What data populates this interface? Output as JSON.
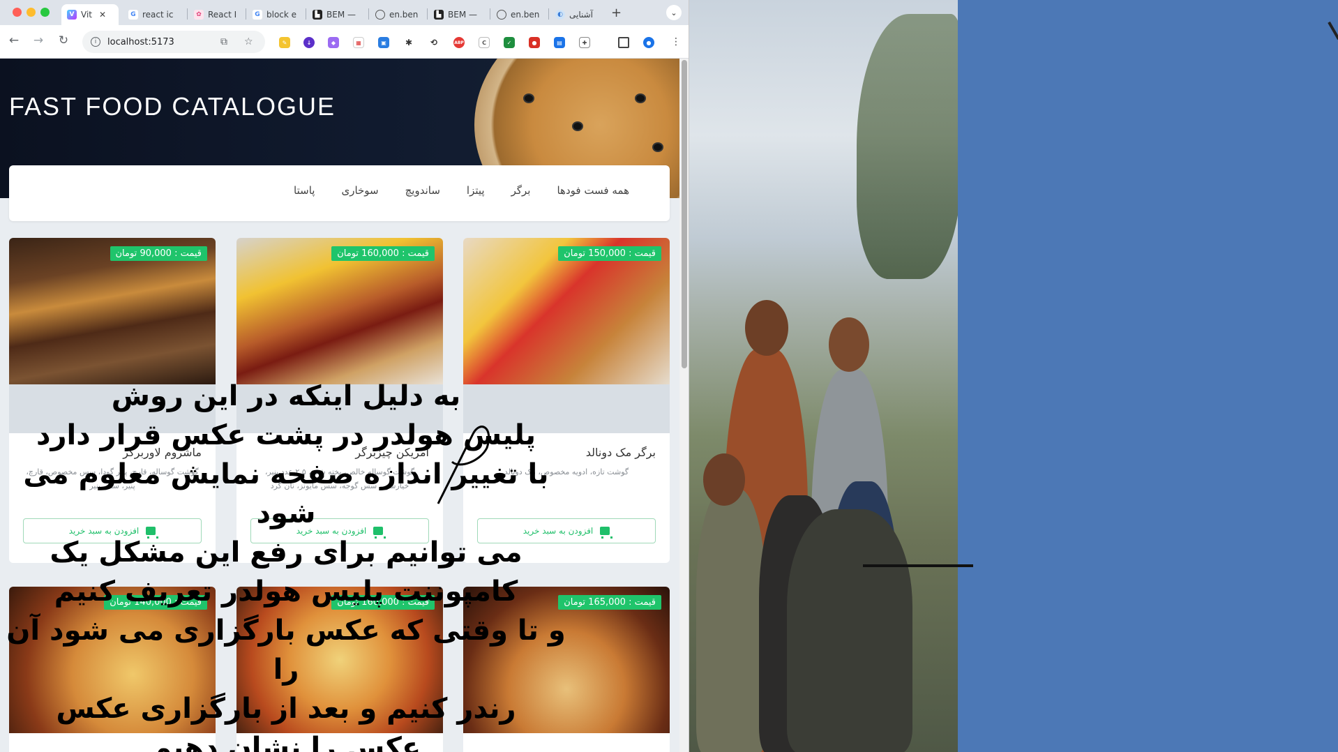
{
  "browser": {
    "tabs": [
      {
        "label": "Vit",
        "icon": "vite-icon",
        "active": true
      },
      {
        "label": "react ic",
        "icon": "google-icon"
      },
      {
        "label": "React I",
        "icon": "react-icon"
      },
      {
        "label": "block e",
        "icon": "google-icon"
      },
      {
        "label": "BEM —",
        "icon": "bem-icon"
      },
      {
        "label": "en.ben",
        "icon": "globe-icon"
      },
      {
        "label": "BEM —",
        "icon": "bem-icon"
      },
      {
        "label": "en.ben",
        "icon": "globe-icon"
      },
      {
        "label": "آشنایی",
        "icon": "site-icon"
      }
    ],
    "url": "localhost:5173"
  },
  "page": {
    "hero_title": "FAST FOOD CATALOGUE",
    "nav": [
      "همه فست فودها",
      "برگر",
      "پیتزا",
      "ساندویچ",
      "سوخاری",
      "پاستا"
    ],
    "cart_label": "افزودن به سبد خرید",
    "cards": [
      {
        "price": "قیمت : 150,000 تومان",
        "name": "برگر مک دونالد",
        "desc": "گوشت تازه، ادویه مخصوص، مک دونالد"
      },
      {
        "price": "قیمت : 160,000 تومان",
        "name": "امریکن چیزبرگر",
        "desc": "گوشت گوساله خالص، پخته شده، ۲.۵ عدد پنیر، خیارشور، سس گوجه، سس مایونز، نان گرد"
      },
      {
        "price": "قیمت : 90,000 تومان",
        "name": "ماشروم لاوربرگر",
        "desc": "گوشت گوساله، قارچ، پنیر گودا، سس مخصوص، قارچ، پنیر، سس پنیر"
      },
      {
        "price": "قیمت : 165,000 تومان"
      },
      {
        "price": "قیمت : 160,000 تومان"
      },
      {
        "price": "قیمت : 140,000 تومان"
      }
    ]
  },
  "overlay": {
    "lines": [
      "به دلیل اینکه در این روش",
      "پلیس هولدر در پشت عکس قرار دارد",
      "با تغییر اندازه صفحه نمایش معلوم می",
      "شود",
      "می توانیم برای رفع این مشکل یک",
      "کامپوننت پلیس هولدر تعریف کنیم",
      "و تا وقتی که عکس بارگزاری می شود آن را",
      "رندر کنیم و بعد از بارگزاری عکس",
      "عکس را نشان دهیم"
    ]
  },
  "colors": {
    "accent_green": "#1fc46b",
    "hero_bg": "#0b1120",
    "desktop_bg": "#4c78b6"
  }
}
